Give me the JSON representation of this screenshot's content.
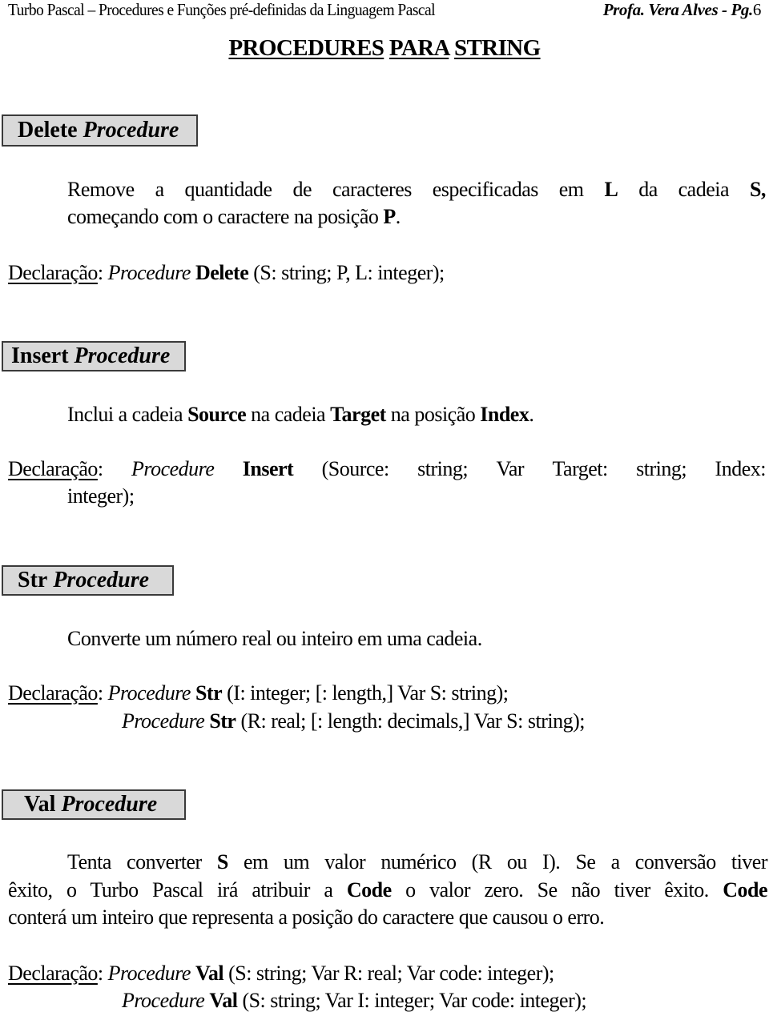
{
  "header": {
    "left": "Turbo Pascal – Procedures e Funções pré-definidas da Linguagem Pascal",
    "author": "Profa. Vera Alves  -  Pg.",
    "page": "6"
  },
  "title": {
    "words": [
      "PROCEDURES",
      "PARA",
      "STRING"
    ]
  },
  "sections": [
    {
      "name": "Delete",
      "suffix": "Procedure",
      "desc_l1": [
        "Remove",
        "a",
        "quantidade",
        "de",
        "caracteres",
        "especificadas",
        "em",
        "L",
        "da",
        "cadeia",
        "S,"
      ],
      "desc_l2_a": "começando com o caractere na posição ",
      "desc_l2_b": "P",
      "desc_l2_c": ".",
      "decl_label": "Declaração",
      "decl": {
        "colon": ": ",
        "kw": "Procedure",
        "name": "Delete",
        "args": " (S: string; P, L: integer);"
      }
    },
    {
      "name": "Insert",
      "suffix": "Procedure",
      "desc": {
        "a": "Inclui a cadeia ",
        "b": "Source",
        "c": " na cadeia ",
        "d": "Target",
        "e": " na posição ",
        "f": "Index",
        "g": "."
      },
      "decl_label": "Declaração",
      "decl": {
        "colon": ":",
        "kw": "Procedure",
        "name": "Insert",
        "args": [
          "(Source:",
          "string;",
          "Var",
          "Target:",
          "string;",
          "Index:"
        ],
        "cont": "integer);"
      }
    },
    {
      "name": "Str",
      "suffix": "Procedure",
      "desc": "Converte um número real ou inteiro em uma cadeia.",
      "decl_label": "Declaração",
      "decl1": {
        "colon": ": ",
        "kw": "Procedure",
        "name": "Str",
        "args": " (I: integer; [: length,] Var S: string);"
      },
      "decl2": {
        "kw": "Procedure",
        "name": "Str",
        "args": " (R: real; [: length: decimals,] Var S: string);"
      }
    },
    {
      "name": "Val",
      "suffix": "Procedure",
      "desc_l1": {
        "a": "Tenta converter ",
        "b": "S",
        "c": " em um valor numérico (R ou I). Se a conversão tiver"
      },
      "desc_l2": {
        "a": "êxito, o Turbo Pascal irá atribuir a ",
        "b": "Code",
        "c": " o valor zero. Se não tiver êxito. ",
        "d": "Code"
      },
      "desc_l3": "conterá um inteiro que representa a posição do caractere que causou o erro.",
      "decl_label": "Declaração",
      "decl1": {
        "colon": ": ",
        "kw": "Procedure",
        "name": "Val",
        "args": " (S: string; Var R: real; Var code: integer);"
      },
      "decl2": {
        "kw": "Procedure",
        "name": "Val",
        "args": " (S: string; Var I: integer; Var code: integer);"
      }
    }
  ]
}
